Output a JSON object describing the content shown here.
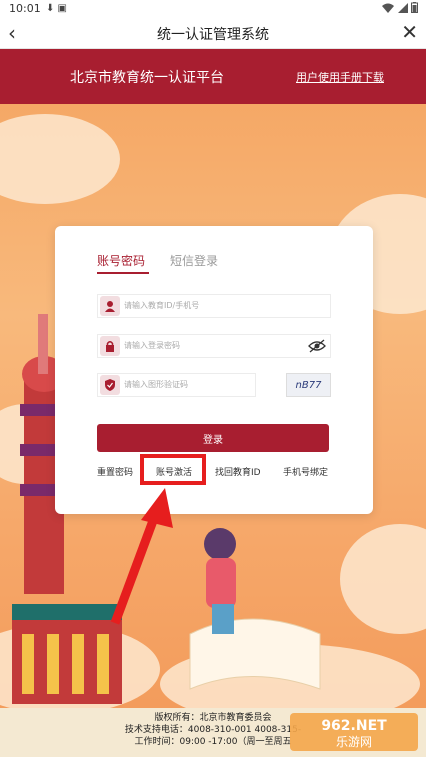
{
  "status": {
    "time": "10:01",
    "icons": "⬇ ▣"
  },
  "nav": {
    "back": "‹",
    "title": "统一认证管理系统",
    "close": "✕"
  },
  "header": {
    "platform": "北京市教育统一认证平台",
    "manual_link": "用户使用手册下载"
  },
  "tabs": {
    "password": "账号密码",
    "sms": "短信登录"
  },
  "fields": {
    "account_placeholder": "请输入教育ID/手机号",
    "password_placeholder": "请输入登录密码",
    "captcha_placeholder": "请输入图形验证码"
  },
  "captcha_text": "nB77",
  "login_label": "登录",
  "links": {
    "reset": "重置密码",
    "activate": "账号激活",
    "find": "找回教育ID",
    "phone": "手机号绑定"
  },
  "footer": {
    "line1": "版权所有：北京市教育委员会",
    "line2": "技术支持电话：4008-310-001 4008-315-",
    "line3": "工作时间：09:00 -17:00（周一至周五"
  },
  "watermark": {
    "top": "962.NET",
    "bottom": "乐游网"
  },
  "colors": {
    "brand_red": "#a81e30",
    "highlight_red": "#e61e1e"
  }
}
